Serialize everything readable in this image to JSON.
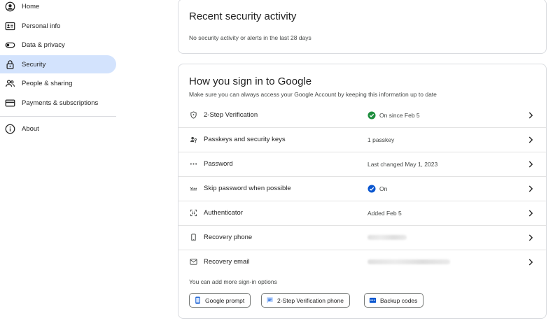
{
  "sidebar": {
    "items": [
      {
        "label": "Home",
        "icon": "account-circle-icon"
      },
      {
        "label": "Personal info",
        "icon": "id-card-icon"
      },
      {
        "label": "Data & privacy",
        "icon": "toggle-icon"
      },
      {
        "label": "Security",
        "icon": "lock-icon",
        "active": true
      },
      {
        "label": "People & sharing",
        "icon": "people-icon"
      },
      {
        "label": "Payments & subscriptions",
        "icon": "credit-card-icon"
      },
      {
        "label": "About",
        "icon": "info-icon"
      }
    ]
  },
  "recent_activity": {
    "title": "Recent security activity",
    "subtitle": "No security activity or alerts in the last 28 days"
  },
  "sign_in": {
    "title": "How you sign in to Google",
    "subtitle": "Make sure you can always access your Google Account by keeping this information up to date",
    "rows": [
      {
        "label": "2-Step Verification",
        "status": "On since Feb 5",
        "icon": "shield-icon",
        "status_icon": "check-circle-icon"
      },
      {
        "label": "Passkeys and security keys",
        "status": "1 passkey",
        "icon": "passkey-icon"
      },
      {
        "label": "Password",
        "status": "Last changed May 1, 2023",
        "icon": "password-dots-icon"
      },
      {
        "label": "Skip password when possible",
        "status": "On",
        "icon": "skip-password-icon",
        "status_icon": "check-circle-blue-icon"
      },
      {
        "label": "Authenticator",
        "status": "Added Feb 5",
        "icon": "authenticator-icon"
      },
      {
        "label": "Recovery phone",
        "status": "",
        "icon": "phone-icon",
        "status_blurred": true
      },
      {
        "label": "Recovery email",
        "status": "",
        "icon": "mail-icon",
        "status_blurred": true
      }
    ],
    "more_note": "You can add more sign-in options",
    "options": [
      {
        "label": "Google prompt",
        "icon": "phone-prompt-icon"
      },
      {
        "label": "2-Step Verification phone",
        "icon": "message-icon"
      },
      {
        "label": "Backup codes",
        "icon": "backup-codes-icon"
      }
    ]
  },
  "colors": {
    "active_nav": "#d3e3fd",
    "accent_blue": "#0b57d0",
    "success_green": "#1e8e3e",
    "border": "#dadce0"
  }
}
